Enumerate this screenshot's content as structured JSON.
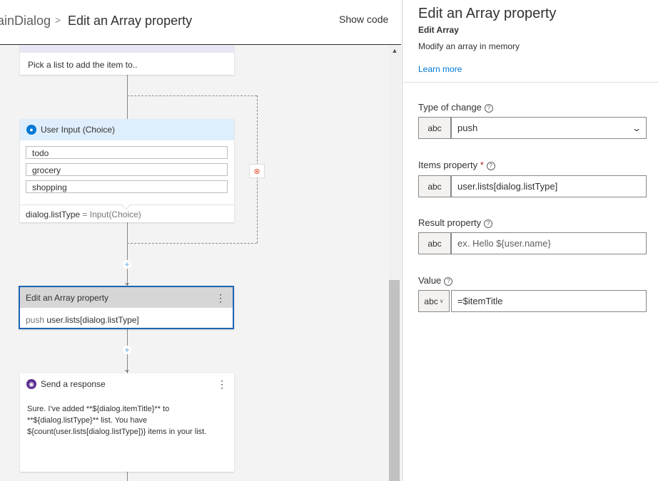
{
  "header": {
    "breadcrumb_root": "ainDialog",
    "breadcrumb_separator": ">",
    "breadcrumb_current": "Edit an Array property",
    "show_code": "Show code"
  },
  "canvas": {
    "top_card_text": "Pick a list to add the item to..",
    "choice_card": {
      "title": "User Input (Choice)",
      "options": [
        "todo",
        "grocery",
        "shopping"
      ],
      "property": "dialog.listType",
      "equals": "=",
      "value": "Input(Choice)"
    },
    "array_card": {
      "title": "Edit an Array property",
      "action": "push",
      "property": "user.lists[dialog.listType]"
    },
    "response_card": {
      "title": "Send a response",
      "text": "Sure. I've added **${dialog.itemTitle}** to **${dialog.listType}** list. You have ${count(user.lists[dialog.listType])} items in your list."
    },
    "menu_glyph": "⋮",
    "plus_glyph": "+",
    "arrow_glyph": "⌄"
  },
  "panel": {
    "title": "Edit an Array property",
    "subtitle": "Edit Array",
    "description": "Modify an array in memory",
    "learn_more": "Learn more",
    "fields": {
      "type_of_change": {
        "label": "Type of change",
        "type": "abc",
        "value": "push"
      },
      "items_property": {
        "label": "Items property",
        "required_mark": "*",
        "type": "abc",
        "value": "user.lists[dialog.listType]"
      },
      "result_property": {
        "label": "Result property",
        "type": "abc",
        "placeholder": "ex. Hello ${user.name}"
      },
      "value": {
        "label": "Value",
        "type": "abc",
        "value": "=$itemTitle"
      }
    },
    "help_glyph": "?"
  },
  "colors": {
    "accent": "#0078d4",
    "selected_border": "#1e64b5",
    "input_header": "#dfeefc",
    "card_header_gray": "#d6d6d6",
    "badge_blue": "#0078d4",
    "badge_purple": "#5c2d91",
    "end_icon": "#e1533a"
  },
  "icons": {
    "user_input": "person-icon",
    "send_response": "chat-bot-icon",
    "end_branch": "stop-circle-icon",
    "dropdown": "chevron-down-icon",
    "help": "help-circle-icon"
  }
}
